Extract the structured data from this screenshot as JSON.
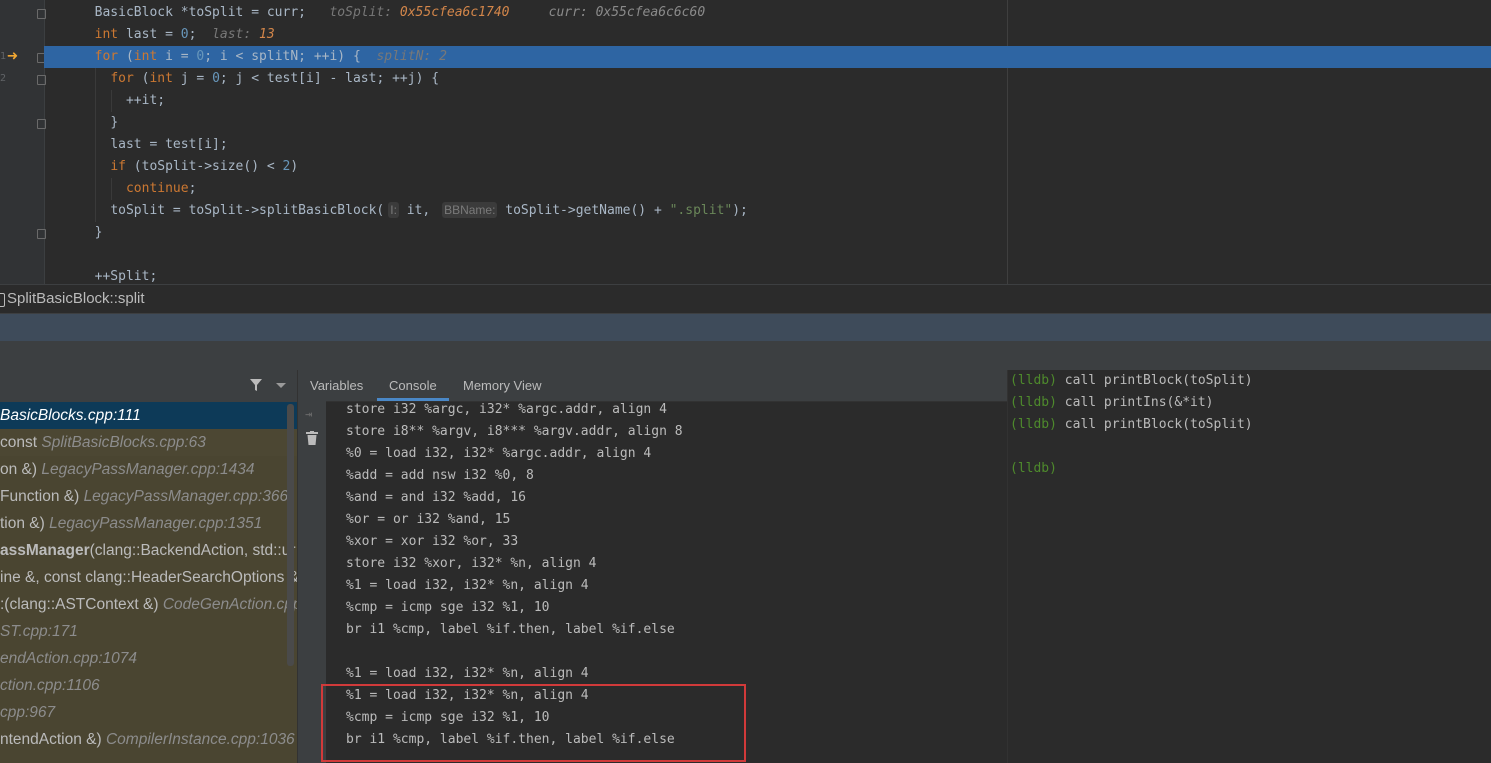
{
  "editor": {
    "lines": [
      {
        "indent": "  ",
        "tokens": [
          [
            "BasicBlock *toSplit = curr;",
            "p"
          ],
          [
            "   toSplit: ",
            "dbg"
          ],
          [
            "0x55cfea6c1740",
            "dbgv"
          ],
          [
            "     curr: 0x55cfea6c6c60",
            "dbgp"
          ]
        ]
      },
      {
        "indent": "  ",
        "tokens": [
          [
            "int",
            "kw"
          ],
          [
            " last = ",
            "p"
          ],
          [
            "0",
            "num"
          ],
          [
            ";",
            "p"
          ],
          [
            "  last: ",
            "dbg"
          ],
          [
            "13",
            "dbgv"
          ]
        ]
      },
      {
        "indent": "  ",
        "tokens": [
          [
            "for",
            "kw"
          ],
          [
            " (",
            "p"
          ],
          [
            "int",
            "kw"
          ],
          [
            " i = ",
            "p"
          ],
          [
            "0",
            "num"
          ],
          [
            "; i < splitN; ++i) {",
            "p"
          ],
          [
            "  splitN: 2",
            "dbg"
          ]
        ]
      },
      {
        "indent": "    ",
        "tokens": [
          [
            "for",
            "kw"
          ],
          [
            " (",
            "p"
          ],
          [
            "int",
            "kw"
          ],
          [
            " j = ",
            "p"
          ],
          [
            "0",
            "num"
          ],
          [
            "; j < test[i] - last; ++j) {",
            "p"
          ]
        ]
      },
      {
        "indent": "      ",
        "tokens": [
          [
            "++it;",
            "p"
          ]
        ]
      },
      {
        "indent": "    ",
        "tokens": [
          [
            "}",
            "p"
          ]
        ]
      },
      {
        "indent": "    ",
        "tokens": [
          [
            "last = test[i];",
            "p"
          ]
        ]
      },
      {
        "indent": "    ",
        "tokens": [
          [
            "if",
            "kw"
          ],
          [
            " (toSplit->size() < ",
            "p"
          ],
          [
            "2",
            "num"
          ],
          [
            ")",
            "p"
          ]
        ]
      },
      {
        "indent": "      ",
        "tokens": [
          [
            "continue",
            "kw"
          ],
          [
            ";",
            "p"
          ]
        ]
      },
      {
        "indent": "    ",
        "tokens": [
          [
            "toSplit = toSplit->splitBasicBlock(",
            "p"
          ],
          [
            "I:",
            "hint"
          ],
          [
            " it, ",
            "p"
          ],
          [
            "BBName:",
            "hint"
          ],
          [
            " toSplit->getName() + ",
            "p"
          ],
          [
            "\".split\"",
            "str"
          ],
          [
            ");",
            "p"
          ]
        ]
      },
      {
        "indent": "  ",
        "tokens": [
          [
            "}",
            "p"
          ]
        ]
      },
      {
        "indent": "",
        "tokens": []
      },
      {
        "indent": "  ",
        "tokens": [
          [
            "++Split;",
            "p"
          ]
        ]
      }
    ],
    "gutter_numbers": [
      "",
      "",
      "1",
      "2",
      "",
      "",
      "",
      "",
      "",
      "",
      "",
      "",
      ""
    ]
  },
  "breadcrumb": {
    "label": "SplitBasicBlock::split"
  },
  "frames_header": {
    "filter_icon": "filter-icon",
    "dropdown_icon": "chevron-down-icon"
  },
  "frames": [
    {
      "name": "BasicBlocks.cpp:111",
      "loc": "",
      "style": "sel",
      "italic_name": true
    },
    {
      "name": " const ",
      "loc": "SplitBasicBlocks.cpp:63",
      "style": "user"
    },
    {
      "name": "on &) ",
      "loc": "LegacyPassManager.cpp:1434",
      "style": "lib"
    },
    {
      "name": "Function &) ",
      "loc": "LegacyPassManager.cpp:366",
      "style": "lib"
    },
    {
      "name": "tion &) ",
      "loc": "LegacyPassManager.cpp:1351",
      "style": "lib"
    },
    {
      "name": "assManager",
      "rest": "(clang::BackendAction, std::ur",
      "loc": "",
      "style": "lib",
      "bold": true
    },
    {
      "name": "ine &, const clang::HeaderSearchOptions &,",
      "loc": "",
      "style": "lib"
    },
    {
      "name": ":(clang::ASTContext &) ",
      "loc": "CodeGenAction.cpp",
      "style": "lib"
    },
    {
      "name": "",
      "loc": "ST.cpp:171",
      "style": "lib"
    },
    {
      "name": "",
      "loc": "endAction.cpp:1074",
      "style": "lib"
    },
    {
      "name": "",
      "loc": "ction.cpp:1106",
      "style": "lib"
    },
    {
      "name": "",
      "loc": "cpp:967",
      "style": "lib"
    },
    {
      "name": "ntendAction &) ",
      "loc": "CompilerInstance.cpp:1036",
      "style": "lib"
    },
    {
      "name": "",
      "loc": "",
      "style": "lib"
    }
  ],
  "tabs": [
    "Variables",
    "Console",
    "Memory View"
  ],
  "active_tab": "Console",
  "console_output": [
    "store i32 %argc, i32* %argc.addr, align 4",
    "store i8** %argv, i8*** %argv.addr, align 8",
    "%0 = load i32, i32* %argc.addr, align 4",
    "%add = add nsw i32 %0, 8",
    "%and = and i32 %add, 16",
    "%or = or i32 %and, 15",
    "%xor = xor i32 %or, 33",
    "store i32 %xor, i32* %n, align 4",
    "%1 = load i32, i32* %n, align 4",
    "%cmp = icmp sge i32 %1, 10",
    "br i1 %cmp, label %if.then, label %if.else",
    "",
    "%1 = load i32, i32* %n, align 4",
    "%1 = load i32, i32* %n, align 4",
    "%cmp = icmp sge i32 %1, 10",
    "br i1 %cmp, label %if.then, label %if.else"
  ],
  "lldb": {
    "prompt": "(lldb)",
    "commands": [
      "call printBlock(toSplit)",
      "call printIns(&*it)",
      "call printBlock(toSplit)",
      "",
      ""
    ]
  },
  "colors": {
    "highlight_line": "#2e65a3",
    "selected_frame": "#0d3a58",
    "redbox": "#d13a3a",
    "lldb_prompt": "#4e8a2c"
  }
}
